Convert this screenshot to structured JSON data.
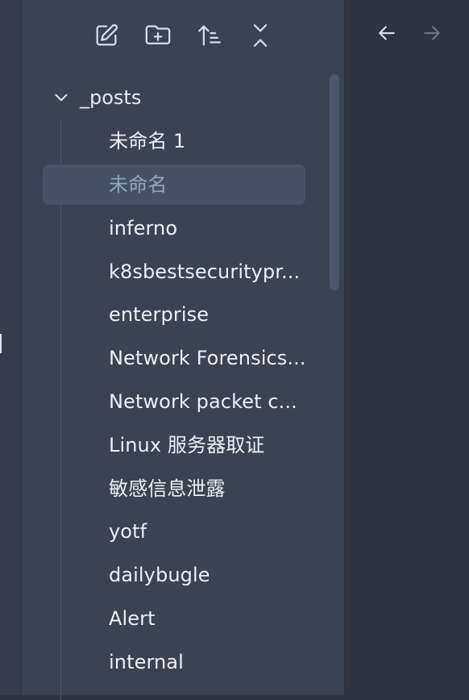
{
  "toolbar": {
    "buttons": [
      {
        "icon": "new-note-icon"
      },
      {
        "icon": "new-folder-icon"
      },
      {
        "icon": "sort-icon"
      },
      {
        "icon": "collapse-all-icon"
      }
    ]
  },
  "navigation": {
    "back_icon": "arrow-left-icon",
    "forward_icon": "arrow-right-icon"
  },
  "tree": {
    "folder_label": "_posts",
    "files": [
      {
        "label": "未命名 1",
        "active": false
      },
      {
        "label": "未命名",
        "active": true
      },
      {
        "label": "inferno",
        "active": false
      },
      {
        "label": "k8sbestsecuritypr...",
        "active": false
      },
      {
        "label": "enterprise",
        "active": false
      },
      {
        "label": "Network Forensics...",
        "active": false
      },
      {
        "label": "Network packet c...",
        "active": false
      },
      {
        "label": "Linux 服务器取证",
        "active": false
      },
      {
        "label": "敏感信息泄露",
        "active": false
      },
      {
        "label": "yotf",
        "active": false
      },
      {
        "label": "dailybugle",
        "active": false
      },
      {
        "label": "Alert",
        "active": false
      },
      {
        "label": "internal",
        "active": false
      }
    ]
  },
  "colors": {
    "sidebar_bg": "#3b4252",
    "active_item_bg": "#485164",
    "active_item_text": "#90a4bd",
    "text": "#eceff4"
  }
}
